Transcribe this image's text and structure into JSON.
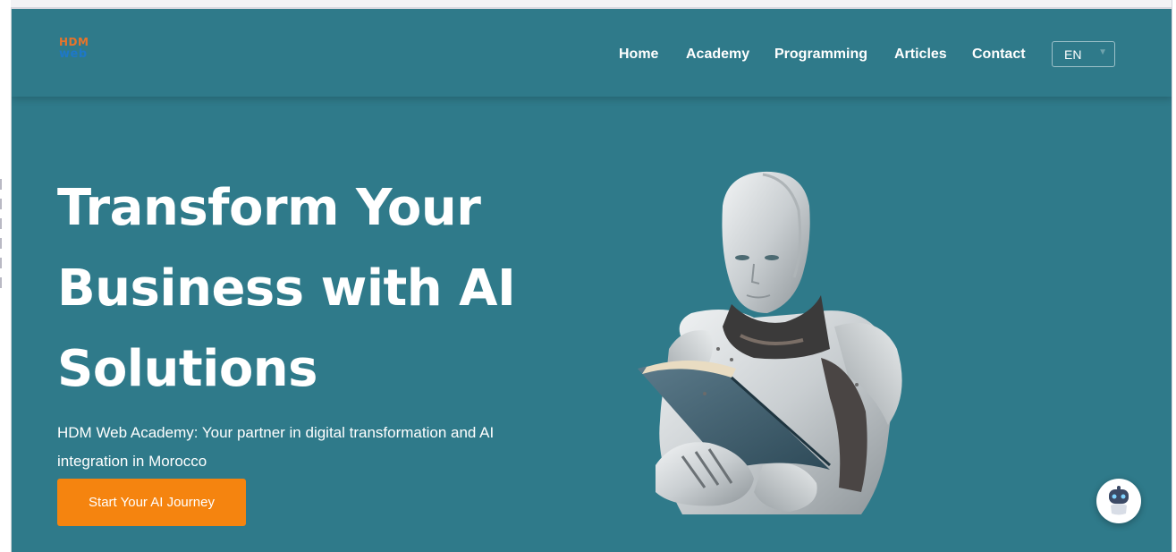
{
  "brand": {
    "logo_top": "HDM",
    "logo_bottom": "web"
  },
  "nav": {
    "items": [
      {
        "label": "Home"
      },
      {
        "label": "Academy"
      },
      {
        "label": "Programming"
      },
      {
        "label": "Articles"
      },
      {
        "label": "Contact"
      }
    ],
    "language": "EN"
  },
  "hero": {
    "title_lines": [
      "Transform Your",
      "Business with AI",
      "Solutions"
    ],
    "subtitle": "HDM Web Academy: Your partner in digital transformation and AI integration in Morocco",
    "cta_label": "Start Your AI Journey"
  },
  "colors": {
    "background": "#2f7a8a",
    "cta": "#f5840f",
    "text": "#ffffff"
  },
  "icons": {
    "chat": "chatbot-robot-icon",
    "language": "chevron-down-icon"
  }
}
